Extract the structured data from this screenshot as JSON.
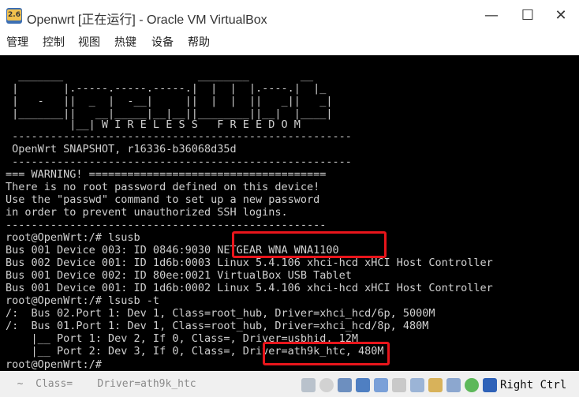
{
  "window": {
    "title": "Openwrt [正在运行] - Oracle VM VirtualBox",
    "app_icon_label": "2.6",
    "minimize_glyph": "—",
    "maximize_glyph": "☐",
    "close_glyph": "✕"
  },
  "menu": [
    "管理",
    "控制",
    "视图",
    "热键",
    "设备",
    "帮助"
  ],
  "console": {
    "logo": [
      "  _______                     ________        __",
      " |       |.-----.-----.-----.|  |  |  |.----.|  |_",
      " |   -   ||  _  |  -__|     ||  |  |  ||   _||   _|",
      " |_______||   __|_____|__|__||________||__|  |____|",
      "          |__| W I R E L E S S   F R E E D O M"
    ],
    "separator": " -----------------------------------------------------",
    "version": " OpenWrt SNAPSHOT, r16336-b36068d35d",
    "warning_header": "=== WARNING! =====================================",
    "warning_lines": [
      "There is no root password defined on this device!",
      "Use the \"passwd\" command to set up a new password",
      "in order to prevent unauthorized SSH logins."
    ],
    "warning_footer": "--------------------------------------------------",
    "prompt_lsusb": "root@OpenWrt:/# lsusb",
    "lsusb_output": [
      "Bus 001 Device 003: ID 0846:9030 NETGEAR WNA WNA1100",
      "Bus 002 Device 001: ID 1d6b:0003 Linux 5.4.106 xhci-hcd xHCI Host Controller",
      "Bus 001 Device 002: ID 80ee:0021 VirtualBox USB Tablet",
      "Bus 001 Device 001: ID 1d6b:0002 Linux 5.4.106 xhci-hcd xHCI Host Controller"
    ],
    "prompt_lsusb_t": "root@OpenWrt:/# lsusb -t",
    "lsusb_t_output": [
      "/:  Bus 02.Port 1: Dev 1, Class=root_hub, Driver=xhci_hcd/6p, 5000M",
      "/:  Bus 01.Port 1: Dev 1, Class=root_hub, Driver=xhci_hcd/8p, 480M",
      "    |__ Port 1: Dev 2, If 0, Class=, Driver=usbhid, 12M",
      "    |__ Port 2: Dev 3, If 0, Class=, Driver=ath9k_htc, 480M"
    ],
    "prompt_final": "root@OpenWrt:/# ",
    "text_color": "#d0d0d0",
    "highlight_color": "#e8151b"
  },
  "statusbar": {
    "ghost_text": "  ~  Class=    Driver=ath9k_htc  ",
    "icons": [
      "hard-disk-icon",
      "optical-disk-icon",
      "audio-icon",
      "network-icon",
      "usb-icon",
      "shared-folders-icon",
      "display-icon",
      "recording-icon",
      "cpu-icon",
      "mouse-integration-icon",
      "keyboard-arrow-icon"
    ],
    "host_key_label": "Right Ctrl"
  }
}
